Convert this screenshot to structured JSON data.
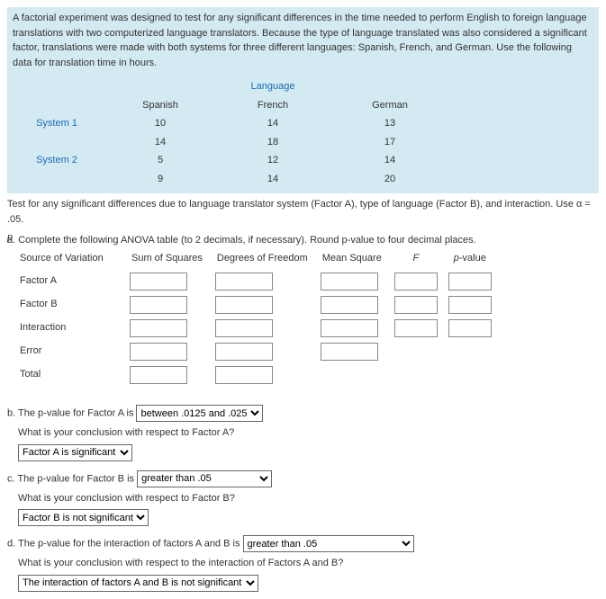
{
  "intro": "A factorial experiment was designed to test for any significant differences in the time needed to perform English to foreign language translations with two computerized language translators. Because the type of language translated was also considered a significant factor, translations were made with both systems for three different languages: Spanish, French, and German. Use the following data for translation time in hours.",
  "data_table": {
    "super_header": "Language",
    "cols": [
      "Spanish",
      "French",
      "German"
    ],
    "rows": [
      {
        "label": "System 1",
        "v": [
          "10",
          "14",
          "13"
        ]
      },
      {
        "label": "",
        "v": [
          "14",
          "18",
          "17"
        ]
      },
      {
        "label": "System 2",
        "v": [
          "5",
          "12",
          "14"
        ]
      },
      {
        "label": "",
        "v": [
          "9",
          "14",
          "20"
        ]
      }
    ]
  },
  "test_line": "Test for any significant differences due to language translator system (Factor A), type of language (Factor B), and interaction. Use α = .05.",
  "a": {
    "prompt": "a. Complete the following ANOVA table (to 2 decimals, if necessary). Round p-value to four decimal places.",
    "headers": [
      "Source of Variation",
      "Sum of Squares",
      "Degrees of Freedom",
      "Mean Square",
      "F",
      "p-value"
    ],
    "sources": [
      "Factor A",
      "Factor B",
      "Interaction",
      "Error",
      "Total"
    ]
  },
  "b": {
    "line_pre": "b. The p-value for Factor A is",
    "sel": "between .0125 and .025",
    "q": "What is your conclusion with respect to Factor A?",
    "ans": "Factor A is significant"
  },
  "c": {
    "line_pre": "c. The p-value for Factor B is",
    "sel": "greater than .05",
    "q": "What is your conclusion with respect to Factor B?",
    "ans": "Factor B is not significant"
  },
  "d": {
    "line_pre": "d. The p-value for the interaction of factors A and B is",
    "sel": "greater than .05",
    "q": "What is your conclusion with respect to the interaction of Factors A and B?",
    "ans": "The interaction of factors A and B is not significant"
  }
}
